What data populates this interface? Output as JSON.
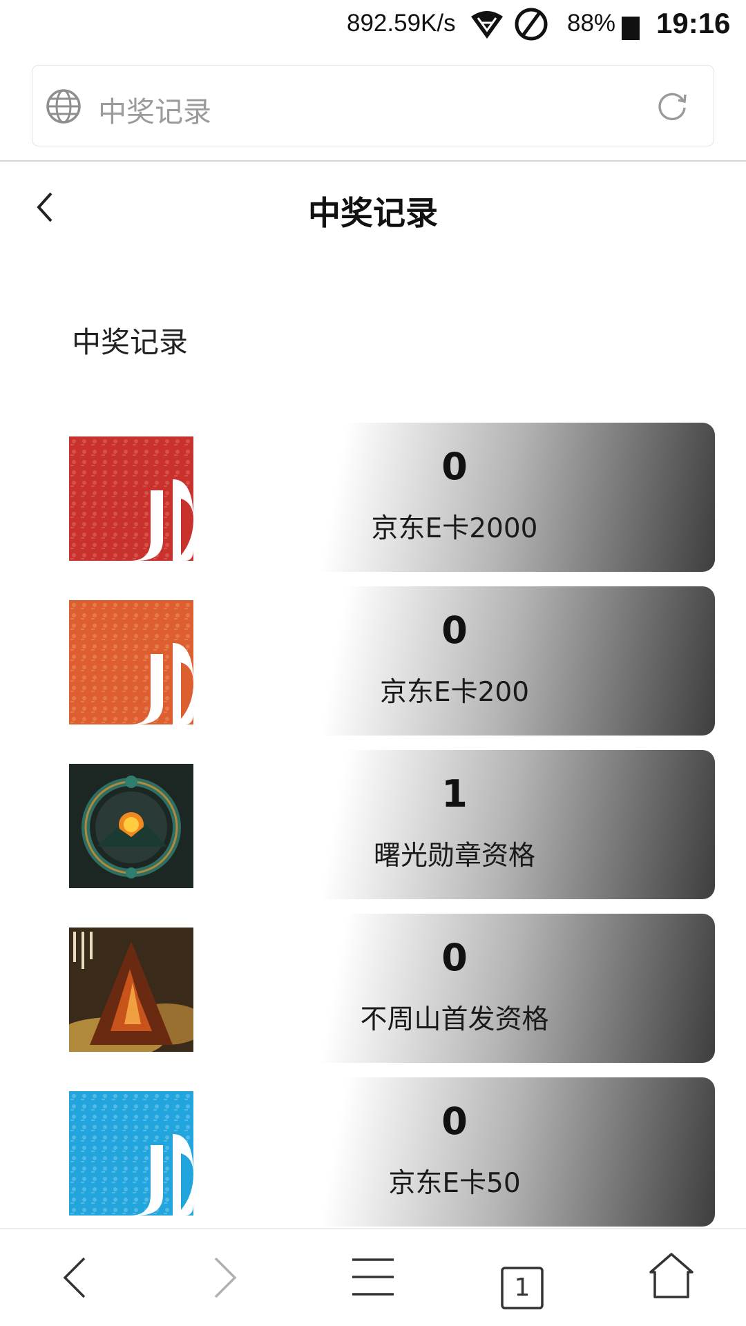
{
  "status_bar": {
    "network_speed": "892.59K/s",
    "battery_percent": "88%",
    "time": "19:16",
    "icons": [
      "wifi-icon",
      "do-not-disturb-icon",
      "battery-icon"
    ]
  },
  "browser": {
    "address_text": "中奖记录",
    "tab_count": "1",
    "icons": [
      "globe-icon",
      "reload-icon",
      "back-icon",
      "forward-icon",
      "menu-icon",
      "tabs-icon",
      "home-icon"
    ]
  },
  "page": {
    "title": "中奖记录",
    "section_title": "中奖记录"
  },
  "prizes": [
    {
      "count": "0",
      "name": "京东E卡2000",
      "image": "jd-card-red"
    },
    {
      "count": "0",
      "name": "京东E卡200",
      "image": "jd-card-orange"
    },
    {
      "count": "1",
      "name": "曙光勋章资格",
      "image": "dawn-medal-art"
    },
    {
      "count": "0",
      "name": "不周山首发资格",
      "image": "buzhou-mountain-art"
    },
    {
      "count": "0",
      "name": "京东E卡50",
      "image": "jd-card-blue"
    }
  ],
  "colors": {
    "jd_red": "#c9322c",
    "jd_orange": "#dd5f2f",
    "jd_blue": "#21a5dc",
    "card_gradient_end": "#3e3e3e"
  }
}
